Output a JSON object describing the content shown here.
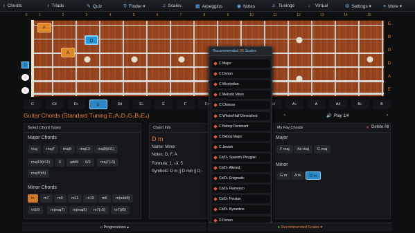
{
  "nav": {
    "items": [
      {
        "icon": "guitar-icon",
        "label": "Chords",
        "glyph": "♪"
      },
      {
        "icon": "triad-icon",
        "label": "Triads",
        "glyph": "♪"
      },
      {
        "icon": "quiz-icon",
        "label": "Quiz",
        "glyph": "✎"
      },
      {
        "icon": "finder-icon",
        "label": "Finder ▾",
        "glyph": "⚲"
      },
      {
        "icon": "scales-icon",
        "label": "Scales",
        "glyph": "♫"
      },
      {
        "icon": "arpeggios-icon",
        "label": "Arpeggios",
        "glyph": "▦"
      },
      {
        "icon": "notes-icon",
        "label": "Notes",
        "glyph": "◉"
      },
      {
        "icon": "tunings-icon",
        "label": "Tunings",
        "glyph": "♬"
      },
      {
        "icon": "virtual-icon",
        "label": "Virtual",
        "glyph": "♩"
      },
      {
        "icon": "settings-icon",
        "label": "Settings ▾",
        "glyph": "⚙"
      },
      {
        "icon": "more-icon",
        "label": "More ▾",
        "glyph": "≡"
      }
    ]
  },
  "fretboard": {
    "fret_numbers": [
      "0",
      "1",
      "2",
      "3",
      "4",
      "5",
      "6",
      "7",
      "8",
      "9",
      "10",
      "11",
      "12",
      "13",
      "14",
      "15"
    ],
    "string_names": [
      "E",
      "B",
      "G",
      "D",
      "A",
      "E"
    ],
    "notes": [
      {
        "label": "F",
        "color": "orange"
      },
      {
        "label": "D",
        "color": "blue"
      },
      {
        "label": "A",
        "color": "orange"
      }
    ],
    "left_markers": [
      {
        "label": "D",
        "type": "blue"
      },
      {
        "label": "⦸",
        "type": "mute"
      },
      {
        "label": "⦸",
        "type": "mute"
      }
    ]
  },
  "keys": {
    "items": [
      "C",
      "C♯",
      "D♭",
      "D",
      "D♯",
      "E♭",
      "E",
      "F",
      "F♯",
      "G♭",
      "G",
      "G♯",
      "A♭",
      "A",
      "A♯",
      "B♭",
      "B"
    ],
    "selected": "D"
  },
  "chord_title": "Guitar Chords (Standard Tuning E₂A₂D₃G₃B₃E₄)",
  "chord_types": {
    "header": "Select Chord Types",
    "major_label": "Major Chords",
    "major": [
      "maj",
      "maj7",
      "maj9",
      "maj13",
      "maj9(♯11)",
      "maj13(♯11)",
      "6",
      "add9",
      "6/9",
      "maj7(♭5)",
      "maj7(♯5)"
    ],
    "minor_label": "Minor Chords",
    "minor": [
      "m",
      "m7",
      "m9",
      "m11",
      "m13",
      "m6",
      "m(add9)",
      "m6/9",
      "m(maj7)",
      "m(maj9)",
      "m7(♭5)",
      "m7(♯5)"
    ],
    "selected": "m"
  },
  "chord_info": {
    "header": "Chord Info",
    "chord": "D m",
    "name": "Name: Minor",
    "notes": "Notes: D, F, A",
    "formula": "Formula: 1, ♭3, 5",
    "symbols": "Symbols: D m || D min || D -"
  },
  "play": {
    "prev": "‹",
    "label": "Play 1/4",
    "speaker": "🔊",
    "next": "›"
  },
  "fav": {
    "header": "My Fav Chords",
    "delete_label": "Delete All",
    "major_label": "Major",
    "major": [
      "F maj",
      "A♯ maj",
      "C maj"
    ],
    "minor_label": "Minor",
    "minor": [
      "G m",
      "A m",
      "D m"
    ],
    "selected": "D m"
  },
  "dropdown": {
    "title_pre": "Recommended",
    "title_count": "95",
    "title_post": "Scales",
    "items": [
      "C Major",
      "C Dorian",
      "C Mixolydian",
      "C Melodic Minor",
      "C Chinese",
      "C Whole/Half Diminished",
      "C Bebop Dominant",
      "C Bebop Major",
      "C Jewish",
      "C♯/D♭ Spanish Phrygian",
      "C♯/D♭ Altered",
      "C♯/D♭ Enigmatic",
      "C♯/D♭ Flamenco",
      "C♯/D♭ Persian",
      "C♯/D♭ Byzantine",
      "D Dorian"
    ]
  },
  "bottom": {
    "progressions": "♫ Progressions ▴",
    "recommended": "Recommended Scales ▾"
  },
  "colors": {
    "accent_orange": "#e9813a",
    "accent_blue": "#2a94d6"
  }
}
